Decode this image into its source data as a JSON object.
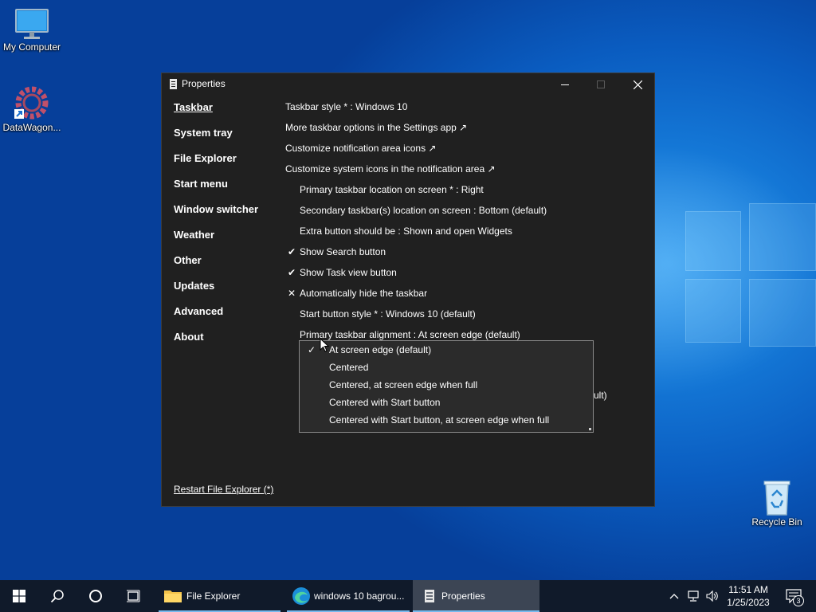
{
  "desktop": {
    "icons": [
      {
        "label": "My Computer"
      },
      {
        "label": "DataWagon..."
      },
      {
        "label": "Recycle Bin"
      }
    ]
  },
  "window": {
    "title": "Properties",
    "controls": {
      "minimize": "minimize-icon",
      "maximize": "maximize-icon",
      "close": "close-icon"
    },
    "nav": [
      {
        "label": "Taskbar",
        "active": true
      },
      {
        "label": "System tray"
      },
      {
        "label": "File Explorer"
      },
      {
        "label": "Start menu"
      },
      {
        "label": "Window switcher"
      },
      {
        "label": "Weather"
      },
      {
        "label": "Other"
      },
      {
        "label": "Updates"
      },
      {
        "label": "Advanced"
      },
      {
        "label": "About"
      }
    ],
    "settings": [
      {
        "label": "Taskbar style * : Windows 10",
        "indent": false,
        "mark": ""
      },
      {
        "label": "More taskbar options in the Settings app ↗",
        "indent": false,
        "mark": ""
      },
      {
        "label": "Customize notification area icons ↗",
        "indent": false,
        "mark": ""
      },
      {
        "label": "Customize system icons in the notification area ↗",
        "indent": false,
        "mark": ""
      },
      {
        "label": "Primary taskbar location on screen * : Right",
        "indent": true,
        "mark": ""
      },
      {
        "label": "Secondary taskbar(s) location on screen : Bottom (default)",
        "indent": true,
        "mark": ""
      },
      {
        "label": "Extra button should be : Shown and open Widgets",
        "indent": true,
        "mark": ""
      },
      {
        "label": "Show Search button",
        "indent": true,
        "mark": "✔"
      },
      {
        "label": "Show Task view button",
        "indent": true,
        "mark": "✔"
      },
      {
        "label": "Automatically hide the taskbar",
        "indent": true,
        "mark": "✕"
      },
      {
        "label": "Start button style * : Windows 10 (default)",
        "indent": true,
        "mark": ""
      },
      {
        "label": "Primary taskbar alignment : At screen edge (default)",
        "indent": true,
        "mark": ""
      }
    ],
    "behind_text": "ult)",
    "footer_link": "Restart File Explorer (*)"
  },
  "dropdown": {
    "options": [
      {
        "label": "At screen edge (default)",
        "checked": true,
        "check": "✓"
      },
      {
        "label": "Centered",
        "checked": false,
        "check": ""
      },
      {
        "label": "Centered, at screen edge when full",
        "checked": false,
        "check": ""
      },
      {
        "label": "Centered with Start button",
        "checked": false,
        "check": ""
      },
      {
        "label": "Centered with Start button, at screen edge when full",
        "checked": false,
        "check": ""
      }
    ]
  },
  "taskbar": {
    "tasks": [
      {
        "label": "File Explorer",
        "icon": "folder-icon"
      },
      {
        "label": "windows 10 bagrou...",
        "icon": "edge-icon"
      },
      {
        "label": "Properties",
        "icon": "properties-icon",
        "active": true
      }
    ],
    "clock": {
      "time": "11:51 AM",
      "date": "1/25/2023"
    },
    "notification_count": "3"
  }
}
